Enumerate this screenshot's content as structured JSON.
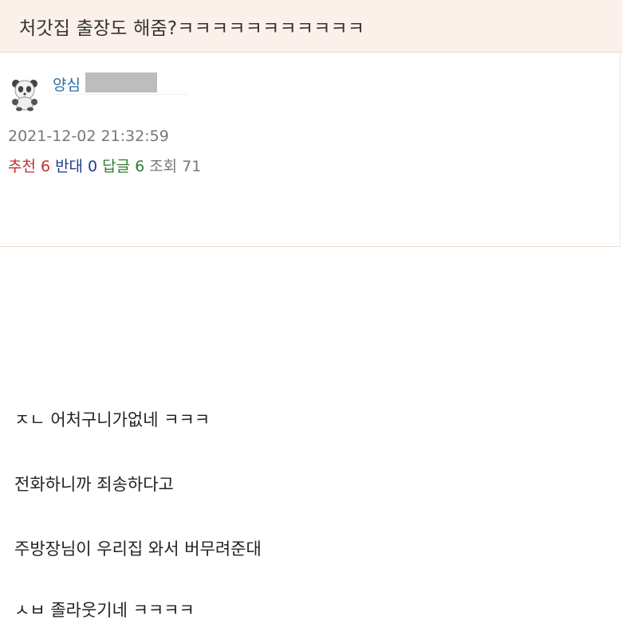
{
  "post": {
    "title": "처갓집 출장도 해줌?ㅋㅋㅋㅋㅋㅋㅋㅋㅋㅋㅋ",
    "author": "양심",
    "avatar_icon": "panda-avatar-icon",
    "datetime": "2021-12-02 21:32:59",
    "stats": {
      "recommend_label": "추천",
      "recommend_count": "6",
      "oppose_label": "반대",
      "oppose_count": "0",
      "reply_label": "답글",
      "reply_count": "6",
      "views_label": "조회",
      "views_count": "71"
    },
    "body_lines": [
      "ㅈㄴ 어처구니가없네 ㅋㅋㅋ",
      "전화하니까 죄송하다고",
      "주방장님이 우리집 와서 버무려준대",
      "ㅅㅂ 졸라웃기네 ㅋㅋㅋㅋ"
    ]
  },
  "colors": {
    "title_bg": "#fbf1ea",
    "author": "#2a6fa6",
    "recommend": "#c0302c",
    "oppose": "#1e3c8c",
    "reply": "#2e7d32",
    "meta": "#777777"
  }
}
